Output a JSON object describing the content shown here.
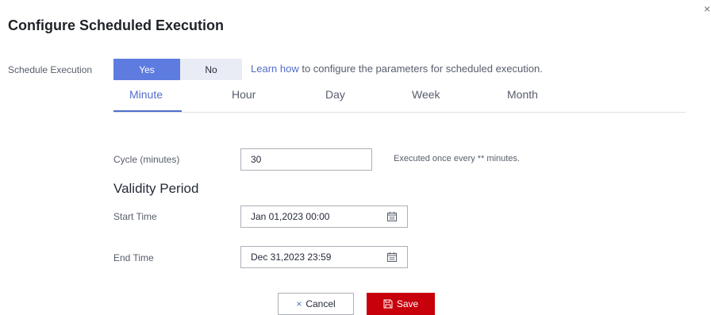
{
  "dialog": {
    "title": "Configure Scheduled Execution",
    "close_glyph": "×"
  },
  "schedule": {
    "label": "Schedule Execution",
    "yes_label": "Yes",
    "no_label": "No",
    "selected": "Yes",
    "helper_link": "Learn how",
    "helper_text": " to configure the parameters for scheduled execution."
  },
  "tabs": [
    {
      "label": "Minute",
      "active": true
    },
    {
      "label": "Hour",
      "active": false
    },
    {
      "label": "Day",
      "active": false
    },
    {
      "label": "Week",
      "active": false
    },
    {
      "label": "Month",
      "active": false
    }
  ],
  "cycle": {
    "label": "Cycle (minutes)",
    "value": "30",
    "hint": "Executed once every ** minutes."
  },
  "validity": {
    "heading": "Validity Period",
    "start_label": "Start Time",
    "start_value": "Jan 01,2023 00:00",
    "end_label": "End Time",
    "end_value": "Dec 31,2023 23:59"
  },
  "footer": {
    "cancel_icon": "×",
    "cancel_label": "Cancel",
    "save_label": "Save"
  },
  "icons": {
    "close": "close-icon",
    "calendar": "calendar-icon",
    "save": "save-icon",
    "cancel": "cancel-x-icon"
  },
  "colors": {
    "primary": "#5e7ce0",
    "link": "#526ecc",
    "danger": "#c7000b"
  }
}
